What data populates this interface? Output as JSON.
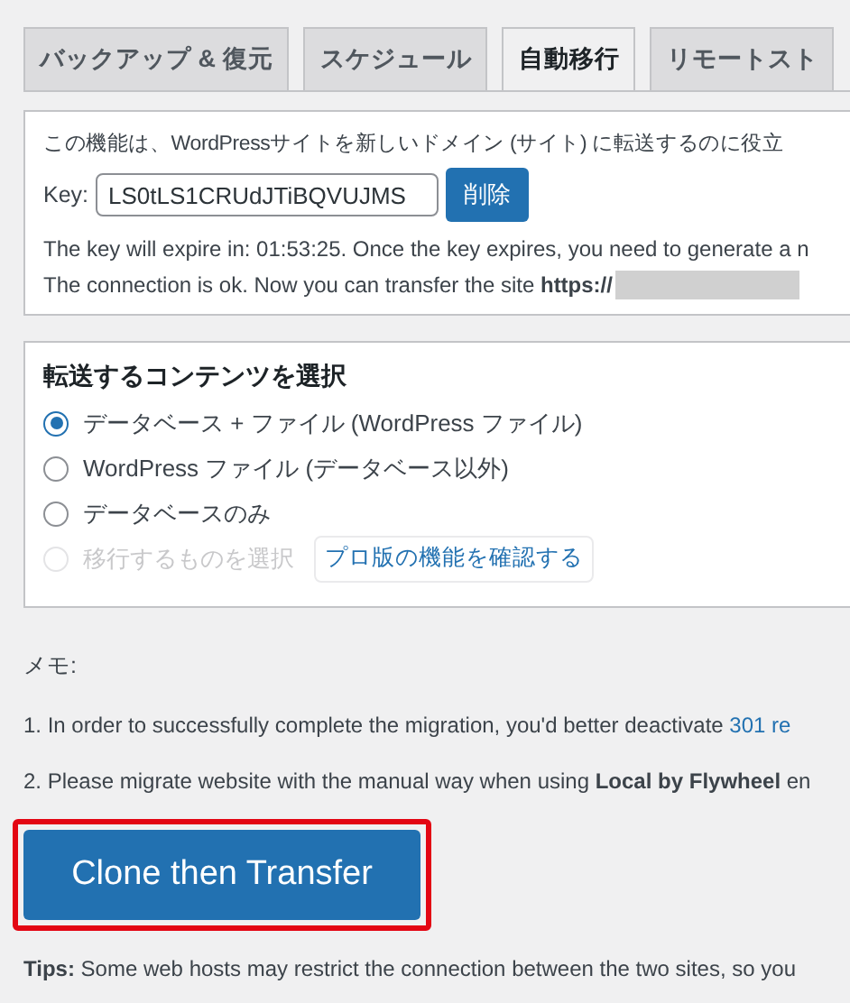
{
  "tabs": [
    {
      "label": "バックアップ & 復元",
      "selected": false
    },
    {
      "label": "スケジュール",
      "selected": false
    },
    {
      "label": "自動移行",
      "selected": true
    },
    {
      "label": "リモートスト",
      "selected": false
    }
  ],
  "key_panel": {
    "intro": "この機能は、WordPressサイトを新しいドメイン (サイト) に転送するのに役立",
    "key_label": "Key:",
    "key_value": "LS0tLS1CRUdJTiBQVUJMS",
    "delete_button": "削除",
    "expire_note": "The key will expire in: 01:53:25. Once the key expires, you need to generate a n",
    "connection_note": "The connection is ok. Now you can transfer the site **https://**",
    "url_redacted": true
  },
  "content_panel": {
    "title": "転送するコンテンツを選択",
    "options": [
      {
        "label": "データベース + ファイル (WordPress ファイル)",
        "selected": true,
        "disabled": false
      },
      {
        "label": "WordPress ファイル (データベース以外)",
        "selected": false,
        "disabled": false
      },
      {
        "label": "データベースのみ",
        "selected": false,
        "disabled": false
      },
      {
        "label": "移行するものを選択",
        "selected": false,
        "disabled": true,
        "pro_button": "プロ版の機能を確認する"
      }
    ]
  },
  "memo": {
    "title": "メモ:",
    "notes": [
      {
        "text": "1. In order to successfully complete the migration, you'd better deactivate ",
        "link": "301 re"
      },
      {
        "text": "2. Please migrate website with the manual way when using **Local by Flywheel** en"
      }
    ]
  },
  "clone_button": {
    "label": "Clone then Transfer",
    "highlighted": true
  },
  "tips": "**Tips:** Some web hosts may restrict the connection between the two sites, so you"
}
